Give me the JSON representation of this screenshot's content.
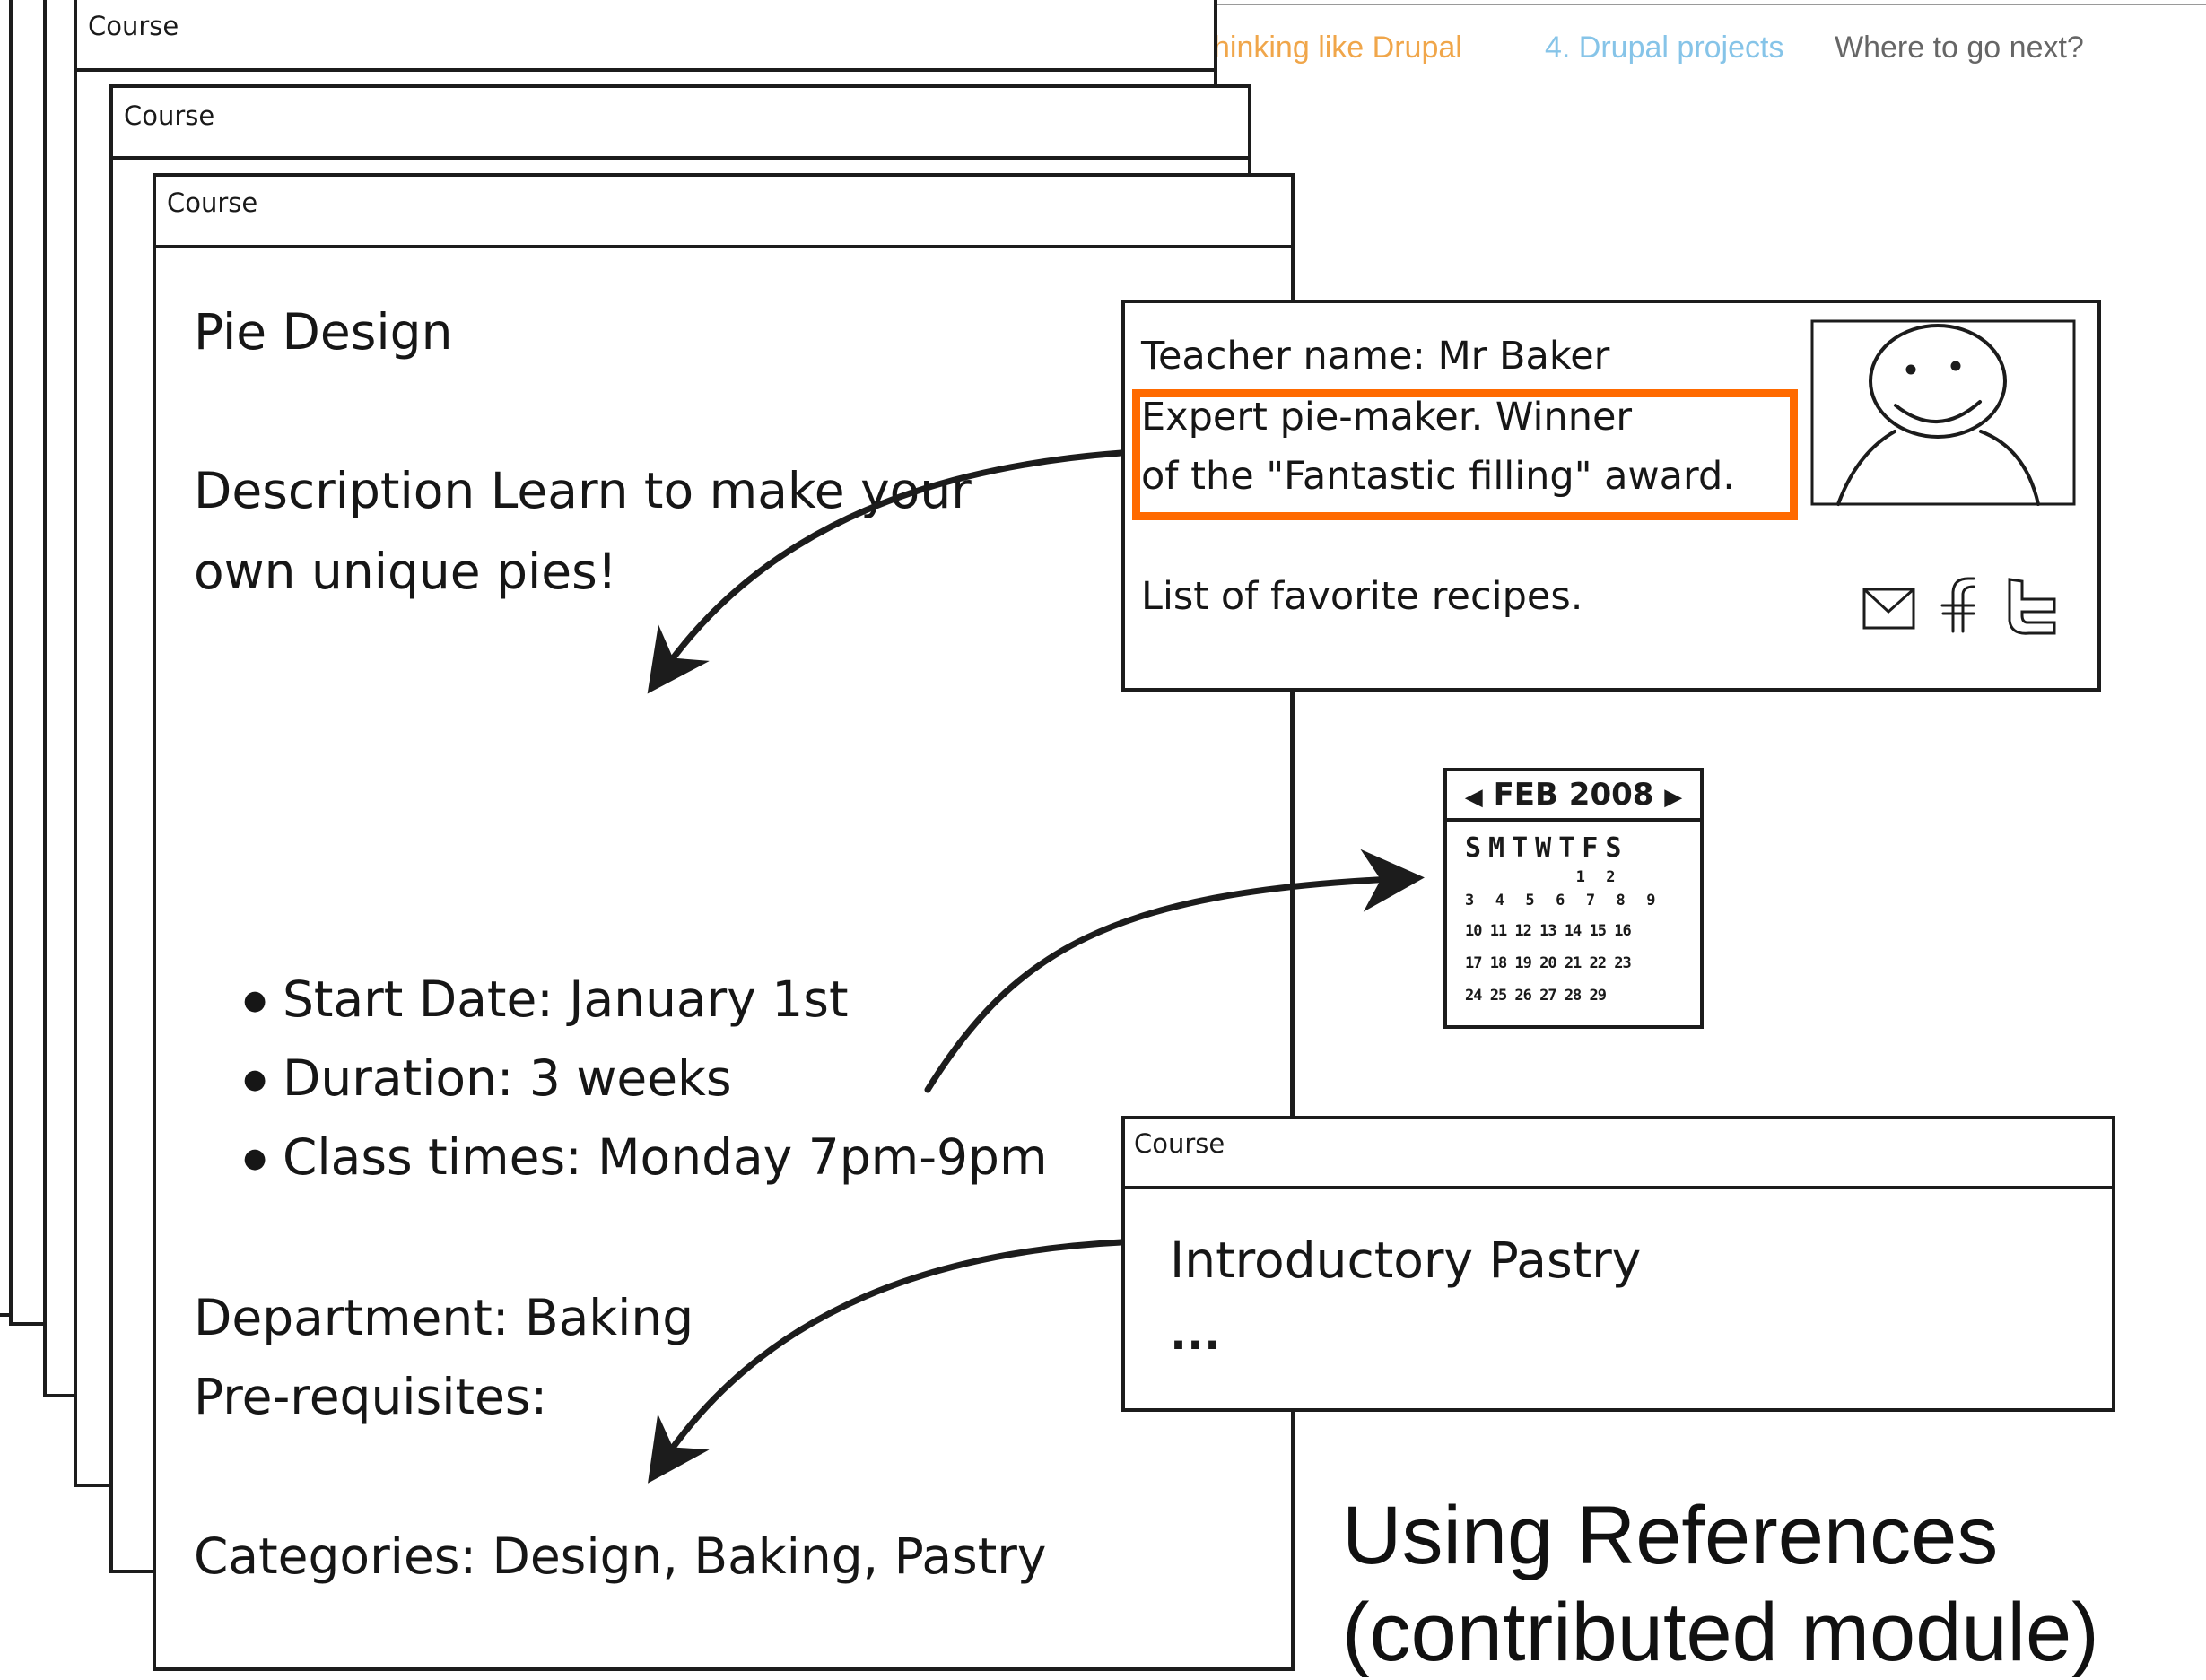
{
  "nav": {
    "item3": "hinking like Drupal",
    "item4": "4. Drupal projects",
    "item5": "Where to go next?"
  },
  "page_header": "Course",
  "course": {
    "title": "Pie Design",
    "description_line1": "Description Learn to make your",
    "description_line2": "own unique pies!",
    "bullets": [
      "Start Date: January 1st",
      "Duration: 3 weeks",
      "Class times: Monday 7pm-9pm"
    ],
    "department": "Department: Baking",
    "prerequisites": "Pre-requisites:",
    "categories": "Categories: Design, Baking, Pastry"
  },
  "teacher": {
    "name_line": "Teacher name: Mr Baker",
    "bio_line1": "Expert pie-maker. Winner",
    "bio_line2": "of the \"Fantastic filling\" award.",
    "recipes_line": "List of favorite recipes.",
    "icons": [
      "envelope-icon",
      "facebook-icon",
      "twitter-icon"
    ],
    "highlight_color": "#ff6a00"
  },
  "calendar": {
    "month_label": "FEB 2008",
    "weekday_header": "SMTWTFS",
    "rows": [
      "           1  2",
      "3  4  5  6  7  8  9",
      "10 11 12 13 14 15 16",
      "17 18 19 20 21 22 23",
      "24 25 26 27 28 29"
    ]
  },
  "related_course": {
    "header": "Course",
    "title": "Introductory Pastry",
    "ellipsis": "..."
  },
  "caption": {
    "line1": "Using References",
    "line2": "(contributed module)"
  }
}
